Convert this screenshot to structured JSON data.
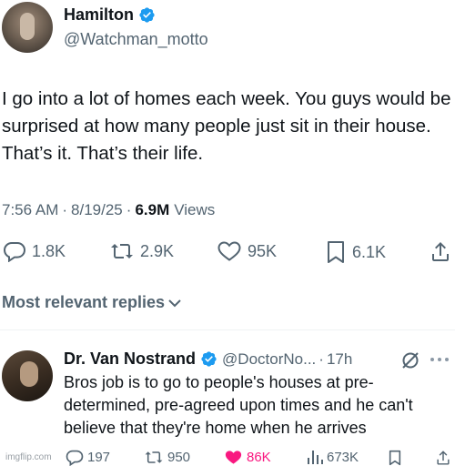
{
  "tweet": {
    "author": {
      "display_name": "Hamilton",
      "handle": "@Watchman_motto",
      "verified": true,
      "verified_color": "#1d9bf0"
    },
    "text": "I go into a lot of homes each week. You guys would be surprised at how many people just sit in their house. That’s it. That’s their life.",
    "meta": {
      "time": "7:56 AM",
      "sep1": "·",
      "date": "8/19/25",
      "sep2": "·",
      "views_count": "6.9M",
      "views_label": "Views"
    },
    "actions": {
      "replies": "1.8K",
      "reposts": "2.9K",
      "likes": "95K",
      "bookmarks": "6.1K"
    }
  },
  "replies_header": {
    "label": "Most relevant replies",
    "icon": "chevron-down-icon"
  },
  "reply": {
    "author": {
      "display_name": "Dr. Van Nostrand",
      "handle": "@DoctorNo...",
      "sep": "·",
      "time": "17h",
      "verified": true
    },
    "text": "Bros job is to go to people's houses at pre-determined, pre-agreed upon times and he can't believe that they're home when he arrives",
    "actions": {
      "replies": "197",
      "reposts": "950",
      "likes": "86K",
      "likes_color": "#f91880",
      "views": "673K"
    }
  },
  "watermark": "imgflip.com"
}
